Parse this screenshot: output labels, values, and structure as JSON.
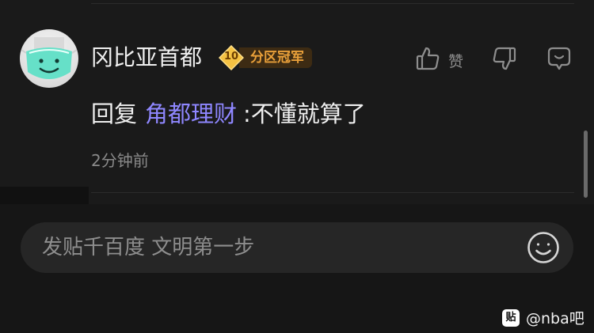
{
  "comment": {
    "username": "冈比亚首都",
    "badge": {
      "level": "10",
      "title": "分区冠军"
    },
    "reply_prefix": "回复",
    "mention": "角都理财",
    "reply_body": ":不懂就算了",
    "timestamp": "2分钟前",
    "like_label": "赞"
  },
  "composer": {
    "placeholder": "发贴千百度 文明第一步"
  },
  "watermark": {
    "logo_text": "贴",
    "text": "@nba吧"
  },
  "icons": {
    "like": "thumbs-up-icon",
    "dislike": "thumbs-down-icon",
    "reply": "comment-bubble-icon",
    "emoji": "smiley-icon",
    "level": "level-diamond-icon"
  },
  "colors": {
    "mention": "#8f87ff",
    "badge_text": "#e9a03a",
    "badge_bg": "#3d2b13",
    "level_gold": "#f5c243"
  }
}
